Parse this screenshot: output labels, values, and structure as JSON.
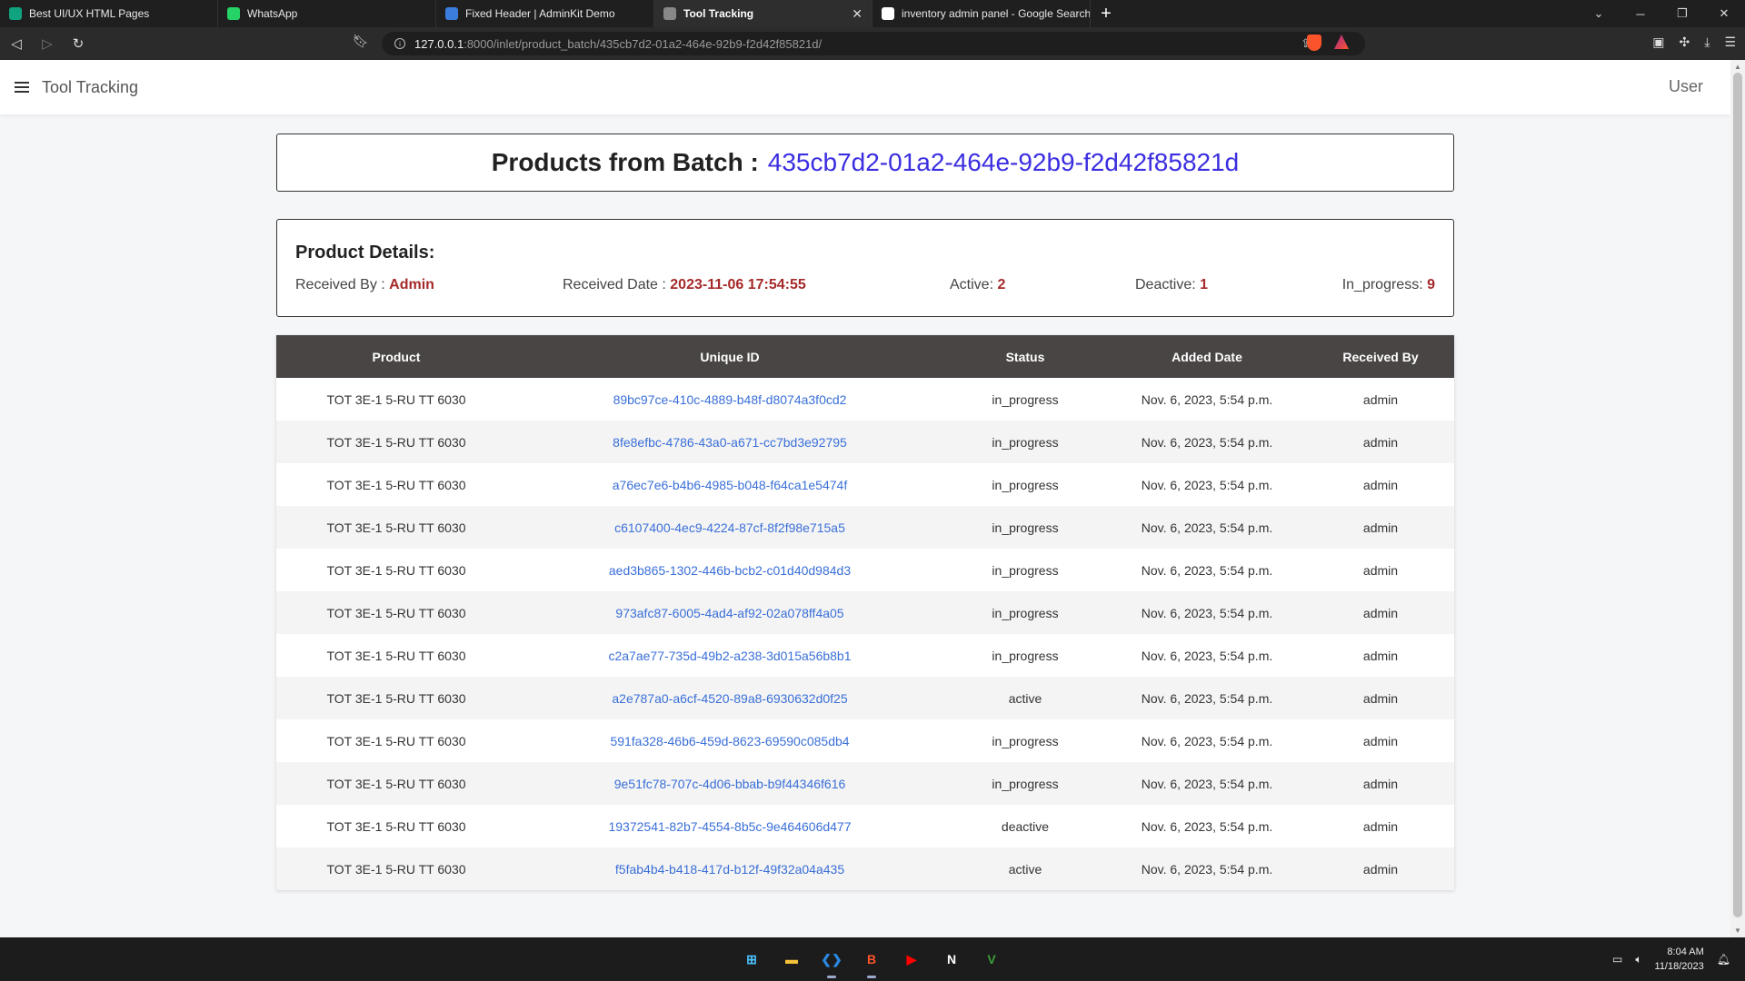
{
  "browser": {
    "tabs": [
      {
        "title": "Best UI/UX HTML Pages",
        "icon": "chatgpt-icon",
        "color": "#10a37f",
        "active": false
      },
      {
        "title": "WhatsApp",
        "icon": "whatsapp-icon",
        "color": "#25d366",
        "active": false
      },
      {
        "title": "Fixed Header | AdminKit Demo",
        "icon": "adminkit-icon",
        "color": "#3b7ddd",
        "active": false
      },
      {
        "title": "Tool Tracking",
        "icon": "globe-icon",
        "color": "#888888",
        "active": true
      },
      {
        "title": "inventory admin panel - Google Search",
        "icon": "google-icon",
        "color": "#ffffff",
        "active": false
      }
    ],
    "new_tab": "+",
    "url_host": "127.0.0.1",
    "url_rest": ":8000/inlet/product_batch/435cb7d2-01a2-464e-92b9-f2d42f85821d/",
    "rewards_badge": "1"
  },
  "navbar": {
    "title": "Tool Tracking",
    "user": "User"
  },
  "header": {
    "prefix": "Products from Batch :",
    "batch_id": "435cb7d2-01a2-464e-92b9-f2d42f85821d"
  },
  "details": {
    "heading": "Product Details:",
    "received_by_label": "Received By : ",
    "received_by": "Admin",
    "received_date_label": "Received Date : ",
    "received_date": "2023-11-06 17:54:55",
    "active_label": "Active: ",
    "active": "2",
    "deactive_label": "Deactive: ",
    "deactive": "1",
    "in_progress_label": "In_progress: ",
    "in_progress": "9"
  },
  "table": {
    "columns": [
      "Product",
      "Unique ID",
      "Status",
      "Added Date",
      "Received By"
    ],
    "rows": [
      [
        "TOT 3E-1 5-RU TT 6030",
        "89bc97ce-410c-4889-b48f-d8074a3f0cd2",
        "in_progress",
        "Nov. 6, 2023, 5:54 p.m.",
        "admin"
      ],
      [
        "TOT 3E-1 5-RU TT 6030",
        "8fe8efbc-4786-43a0-a671-cc7bd3e92795",
        "in_progress",
        "Nov. 6, 2023, 5:54 p.m.",
        "admin"
      ],
      [
        "TOT 3E-1 5-RU TT 6030",
        "a76ec7e6-b4b6-4985-b048-f64ca1e5474f",
        "in_progress",
        "Nov. 6, 2023, 5:54 p.m.",
        "admin"
      ],
      [
        "TOT 3E-1 5-RU TT 6030",
        "c6107400-4ec9-4224-87cf-8f2f98e715a5",
        "in_progress",
        "Nov. 6, 2023, 5:54 p.m.",
        "admin"
      ],
      [
        "TOT 3E-1 5-RU TT 6030",
        "aed3b865-1302-446b-bcb2-c01d40d984d3",
        "in_progress",
        "Nov. 6, 2023, 5:54 p.m.",
        "admin"
      ],
      [
        "TOT 3E-1 5-RU TT 6030",
        "973afc87-6005-4ad4-af92-02a078ff4a05",
        "in_progress",
        "Nov. 6, 2023, 5:54 p.m.",
        "admin"
      ],
      [
        "TOT 3E-1 5-RU TT 6030",
        "c2a7ae77-735d-49b2-a238-3d015a56b8b1",
        "in_progress",
        "Nov. 6, 2023, 5:54 p.m.",
        "admin"
      ],
      [
        "TOT 3E-1 5-RU TT 6030",
        "a2e787a0-a6cf-4520-89a8-6930632d0f25",
        "active",
        "Nov. 6, 2023, 5:54 p.m.",
        "admin"
      ],
      [
        "TOT 3E-1 5-RU TT 6030",
        "591fa328-46b6-459d-8623-69590c085db4",
        "in_progress",
        "Nov. 6, 2023, 5:54 p.m.",
        "admin"
      ],
      [
        "TOT 3E-1 5-RU TT 6030",
        "9e51fc78-707c-4d06-bbab-b9f44346f616",
        "in_progress",
        "Nov. 6, 2023, 5:54 p.m.",
        "admin"
      ],
      [
        "TOT 3E-1 5-RU TT 6030",
        "19372541-82b7-4554-8b5c-9e464606d477",
        "deactive",
        "Nov. 6, 2023, 5:54 p.m.",
        "admin"
      ],
      [
        "TOT 3E-1 5-RU TT 6030",
        "f5fab4b4-b418-417d-b12f-49f32a04a435",
        "active",
        "Nov. 6, 2023, 5:54 p.m.",
        "admin"
      ]
    ]
  },
  "taskbar": {
    "apps": [
      {
        "icon": "windows-start-icon",
        "glyph": "⊞",
        "color": "#4cc2ff"
      },
      {
        "icon": "file-explorer-icon",
        "glyph": "▬",
        "color": "#f3c13a"
      },
      {
        "icon": "vscode-icon",
        "glyph": "❮❯",
        "color": "#2a8ae3"
      },
      {
        "icon": "brave-browser-icon",
        "glyph": "B",
        "color": "#fb542b"
      },
      {
        "icon": "youtube-icon",
        "glyph": "▶",
        "color": "#ff0000"
      },
      {
        "icon": "notion-icon",
        "glyph": "N",
        "color": "#ffffff"
      },
      {
        "icon": "vim-icon",
        "glyph": "V",
        "color": "#3ba03b"
      }
    ],
    "time": "8:04 AM",
    "date": "11/18/2023"
  },
  "colors": {
    "accent_blue": "#3b2ee0",
    "value_red": "#a52a2a",
    "table_header": "#484544",
    "link_blue": "#3a6fd8"
  }
}
